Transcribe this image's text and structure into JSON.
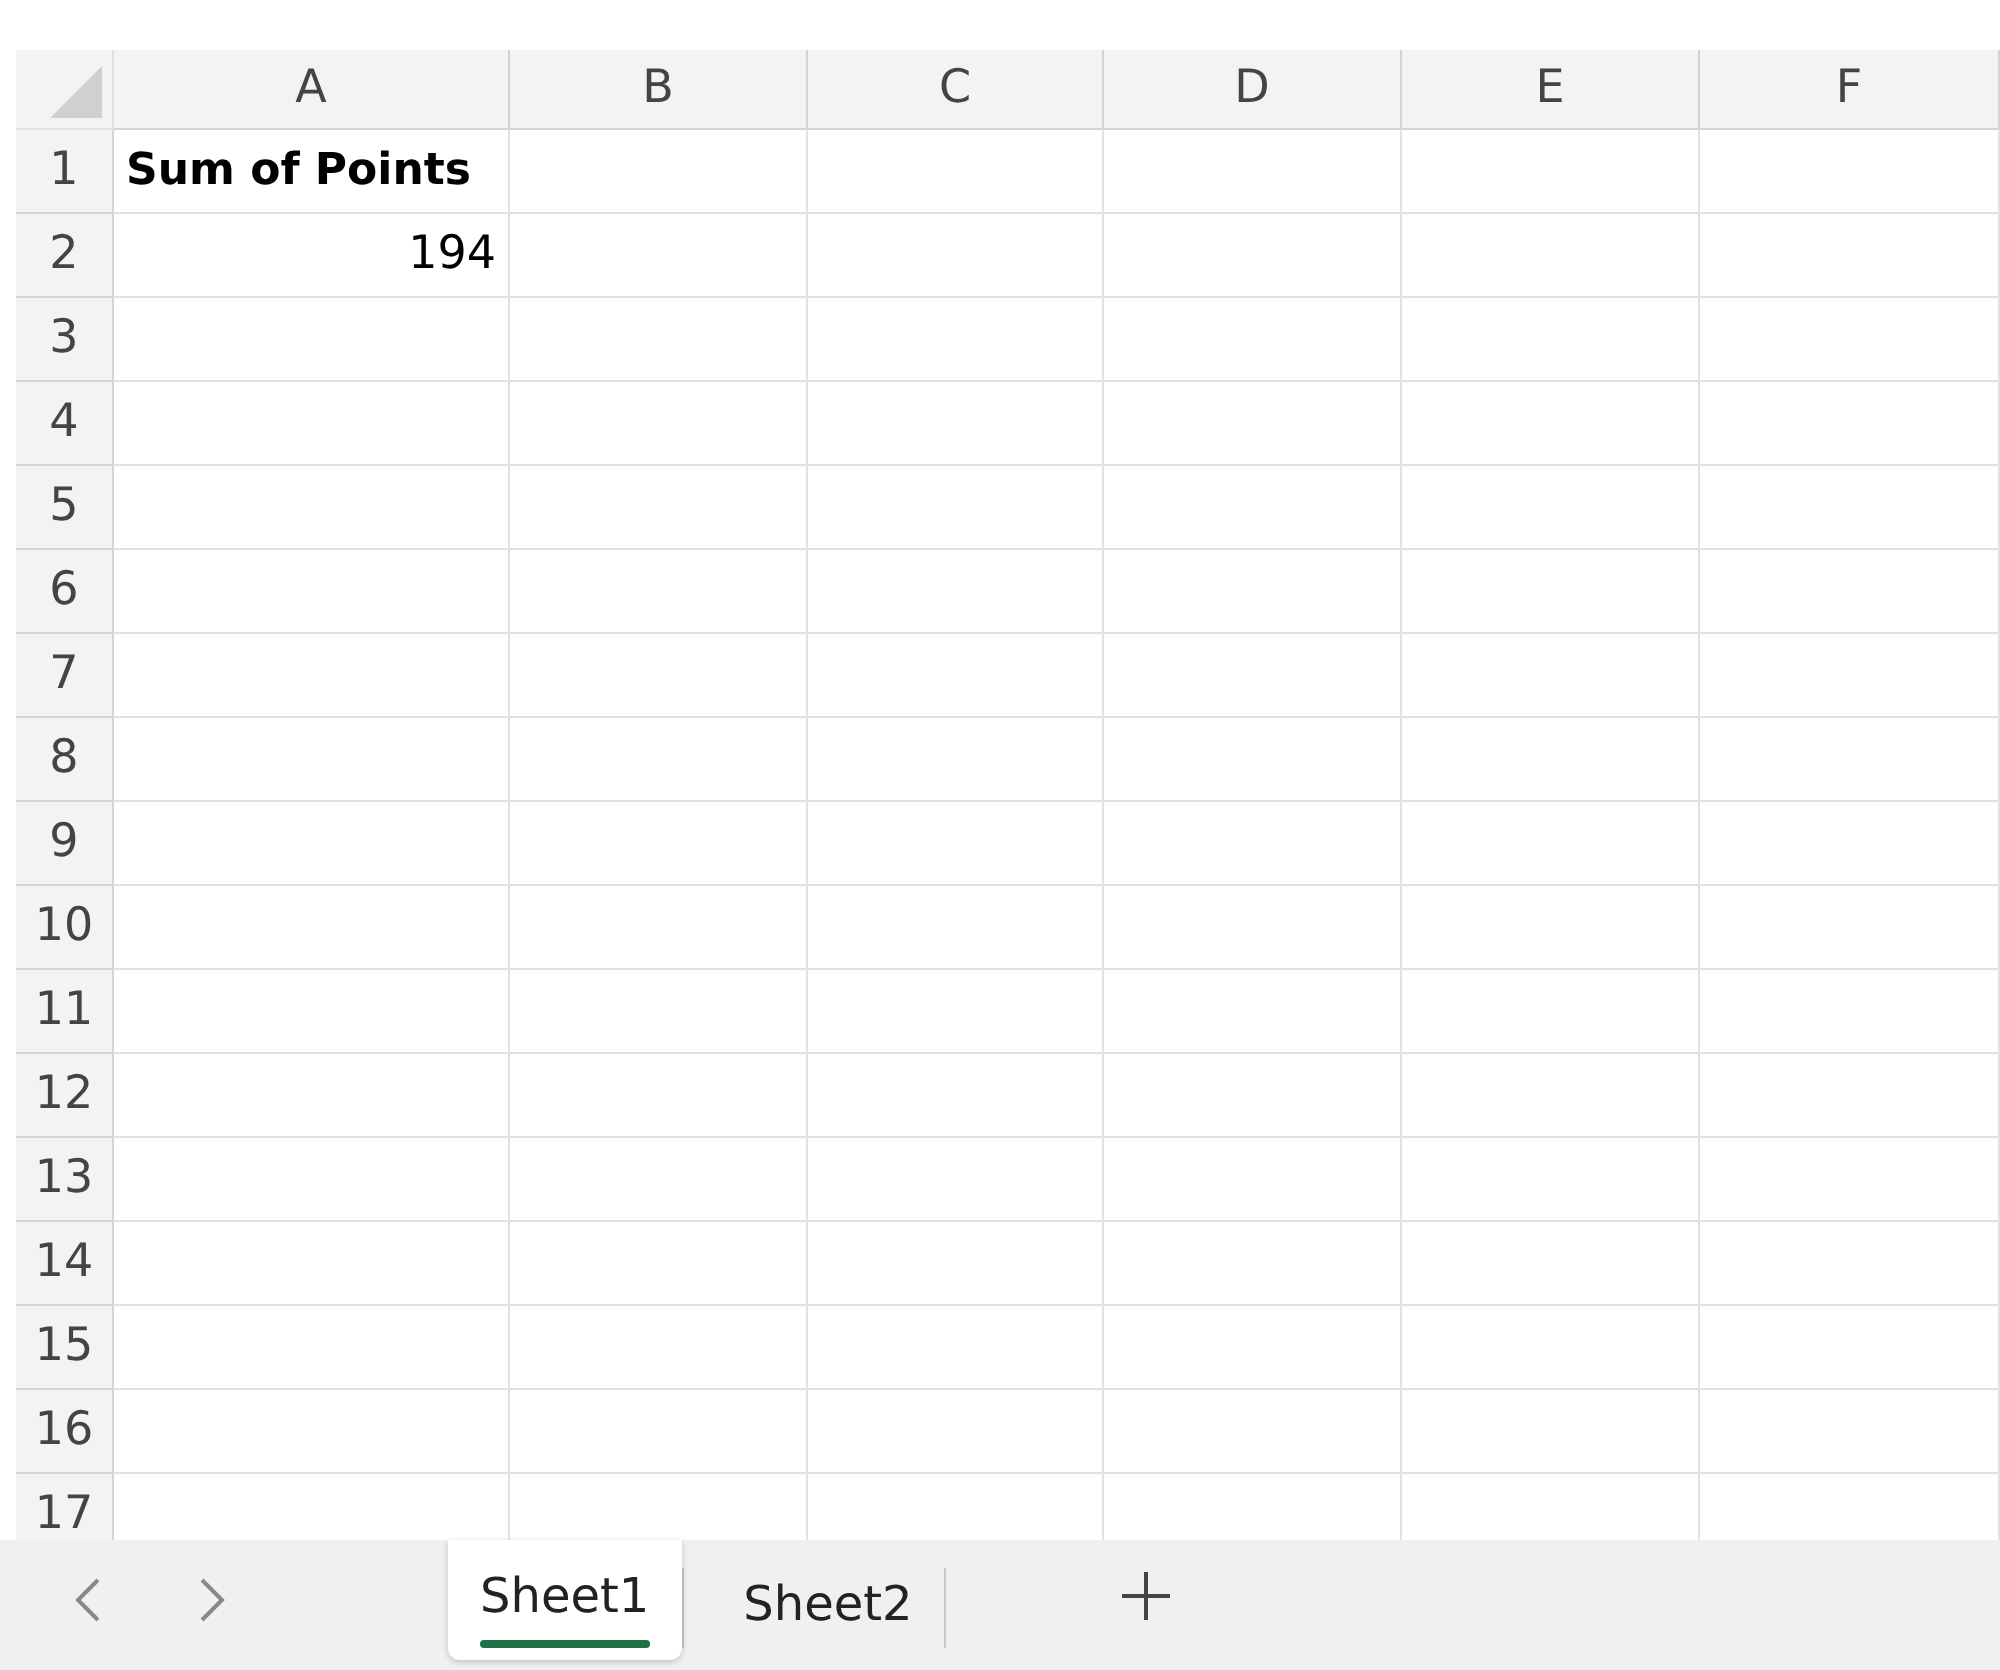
{
  "columns": [
    "A",
    "B",
    "C",
    "D",
    "E",
    "F"
  ],
  "rows": [
    {
      "number": "1",
      "cells": [
        {
          "text": "Sum of Points",
          "kind": "label"
        }
      ]
    },
    {
      "number": "2",
      "cells": [
        {
          "text": "194",
          "kind": "number"
        }
      ]
    },
    {
      "number": "3"
    },
    {
      "number": "4"
    },
    {
      "number": "5"
    },
    {
      "number": "6"
    },
    {
      "number": "7"
    },
    {
      "number": "8"
    },
    {
      "number": "9"
    },
    {
      "number": "10"
    },
    {
      "number": "11"
    },
    {
      "number": "12"
    },
    {
      "number": "13"
    },
    {
      "number": "14"
    },
    {
      "number": "15"
    },
    {
      "number": "16"
    },
    {
      "number": "17"
    }
  ],
  "sheet_tabs": [
    {
      "label": "Sheet1",
      "selected": true
    },
    {
      "label": "Sheet2",
      "selected": false
    }
  ]
}
